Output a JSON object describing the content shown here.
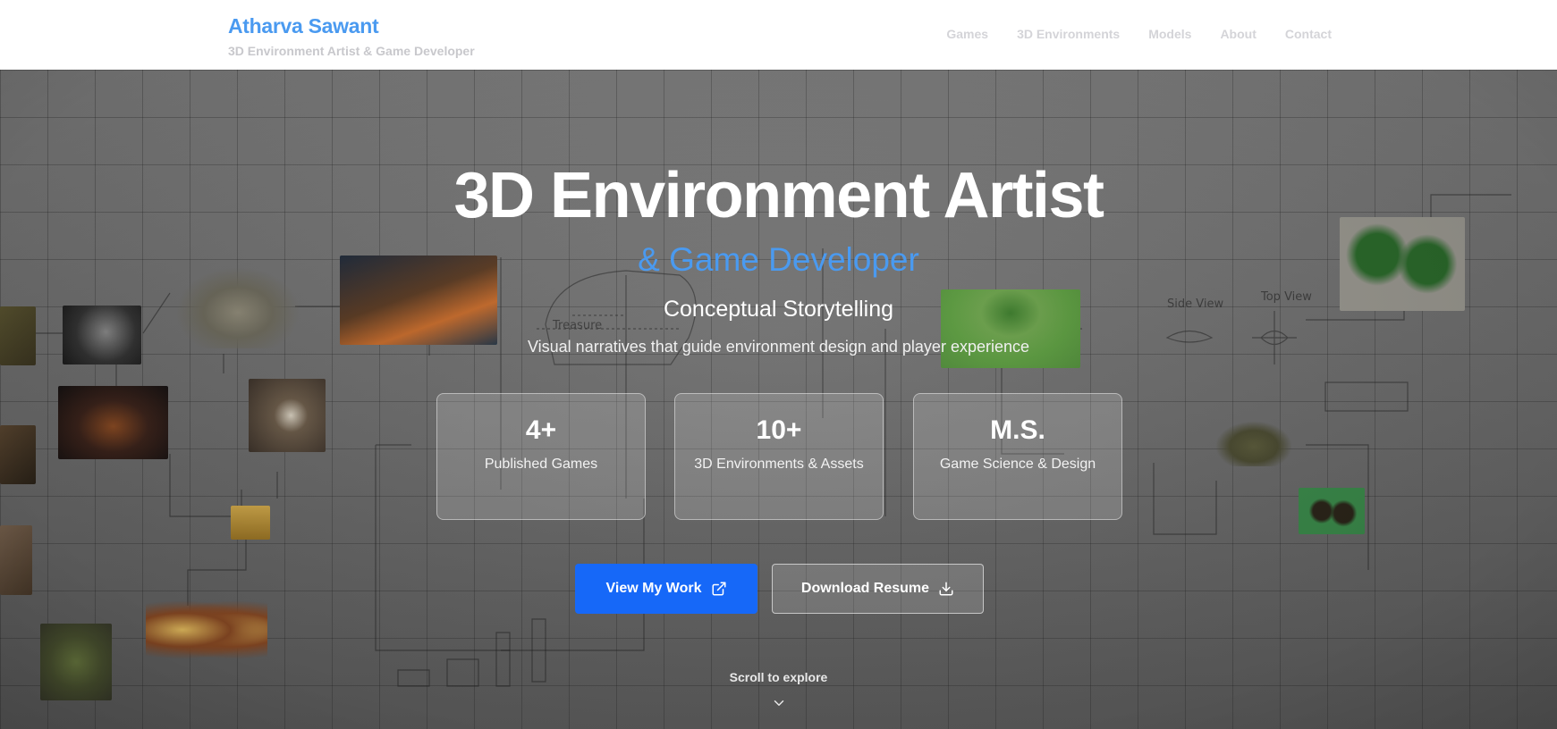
{
  "header": {
    "brand_name": "Atharva Sawant",
    "brand_subtitle": "3D Environment Artist & Game Developer",
    "nav": [
      {
        "label": "Games"
      },
      {
        "label": "3D Environments"
      },
      {
        "label": "Models"
      },
      {
        "label": "About"
      },
      {
        "label": "Contact"
      }
    ]
  },
  "hero": {
    "title": "3D Environment Artist",
    "subtitle": "& Game Developer",
    "tagline": "Conceptual Storytelling",
    "description": "Visual narratives that guide environment design and player experience",
    "stats": [
      {
        "value": "4+",
        "label": "Published Games"
      },
      {
        "value": "10+",
        "label": "3D Environments & Assets"
      },
      {
        "value": "M.S.",
        "label": "Game Science & Design"
      }
    ],
    "primary_button": "View My Work",
    "secondary_button": "Download Resume",
    "scroll_hint": "Scroll to explore"
  },
  "sketch_labels": {
    "treasure": "Treasure",
    "side_view": "Side View",
    "top_view": "Top View"
  },
  "colors": {
    "accent": "#4a9af0",
    "primary_button": "#1668f8",
    "header_bg": "#ffffff"
  },
  "icons": {
    "primary_button_icon": "external-link-icon",
    "secondary_button_icon": "download-icon",
    "scroll_icon": "chevron-down-icon"
  }
}
